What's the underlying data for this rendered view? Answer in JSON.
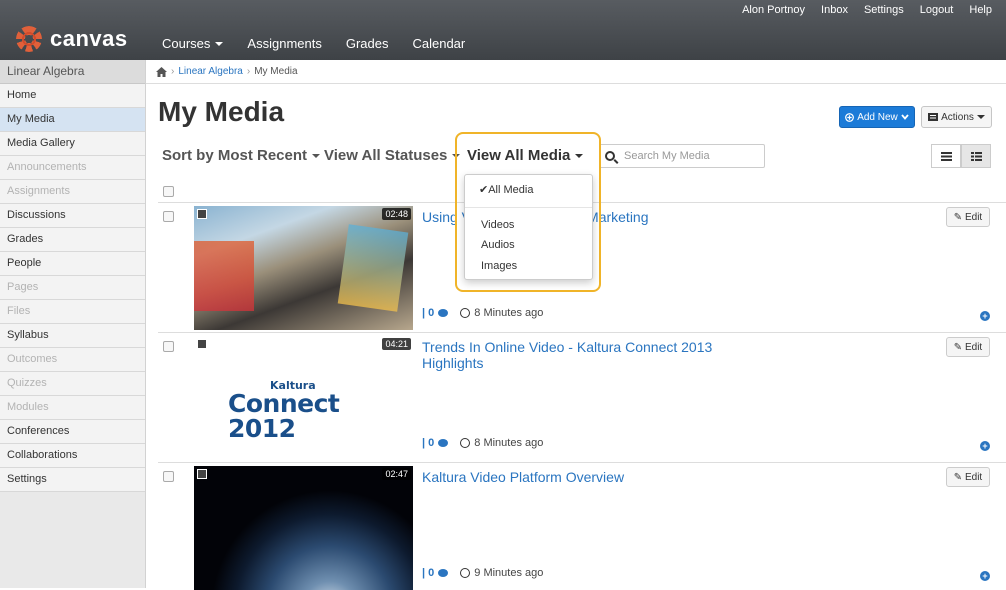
{
  "app": {
    "logo_text": "canvas"
  },
  "utility_nav": [
    "Alon Portnoy",
    "Inbox",
    "Settings",
    "Logout",
    "Help"
  ],
  "main_nav": [
    {
      "label": "Courses",
      "dropdown": true
    },
    {
      "label": "Assignments"
    },
    {
      "label": "Grades"
    },
    {
      "label": "Calendar"
    }
  ],
  "sidebar": {
    "course": "Linear Algebra",
    "items": [
      {
        "label": "Home"
      },
      {
        "label": "My Media",
        "active": true
      },
      {
        "label": "Media Gallery"
      },
      {
        "label": "Announcements",
        "disabled": true
      },
      {
        "label": "Assignments",
        "disabled": true
      },
      {
        "label": "Discussions"
      },
      {
        "label": "Grades"
      },
      {
        "label": "People"
      },
      {
        "label": "Pages",
        "disabled": true
      },
      {
        "label": "Files",
        "disabled": true
      },
      {
        "label": "Syllabus"
      },
      {
        "label": "Outcomes",
        "disabled": true
      },
      {
        "label": "Quizzes",
        "disabled": true
      },
      {
        "label": "Modules",
        "disabled": true
      },
      {
        "label": "Conferences"
      },
      {
        "label": "Collaborations"
      },
      {
        "label": "Settings"
      }
    ]
  },
  "breadcrumb": {
    "course": "Linear Algebra",
    "current": "My Media"
  },
  "page": {
    "title": "My Media",
    "add_new_label": "Add New",
    "actions_label": "Actions"
  },
  "filters": {
    "sort_label": "Sort by Most Recent",
    "status_label": "View All Statuses",
    "media_label": "View All Media",
    "search_placeholder": "Search My Media",
    "media_options": [
      "All Media",
      "Videos",
      "Audios",
      "Images"
    ],
    "media_selected": "All Media"
  },
  "entries": [
    {
      "title": "Using Video for Marketing",
      "title_visible_start": "Using V",
      "title_visible_end": "Marketing",
      "duration": "02:48",
      "comments": "0",
      "time": "8 Minutes ago",
      "edit_label": "Edit"
    },
    {
      "title": "Trends In Online Video - Kaltura Connect 2013 Highlights",
      "duration": "04:21",
      "comments": "0",
      "time": "8 Minutes ago",
      "edit_label": "Edit",
      "thumb_logo_small": "Kaltura",
      "thumb_logo_big": "Connect 2012"
    },
    {
      "title": "Kaltura Video Platform Overview",
      "duration": "02:47",
      "comments": "0",
      "time": "9 Minutes ago",
      "edit_label": "Edit"
    }
  ],
  "colors": {
    "topbar": "#4a4e53",
    "link": "#2a75c0",
    "primary_button": "#1c7bd8",
    "highlight": "#f0b429",
    "active_sidebar": "#d5e3f2"
  },
  "icons": [
    "canvas-logo-icon",
    "home-icon",
    "caret-down-icon",
    "plus-circle-icon",
    "actions-icon",
    "search-icon",
    "list-view-icon",
    "detail-view-icon",
    "checkmark-icon",
    "film-icon",
    "comment-icon",
    "clock-icon",
    "pencil-icon",
    "expand-icon"
  ]
}
